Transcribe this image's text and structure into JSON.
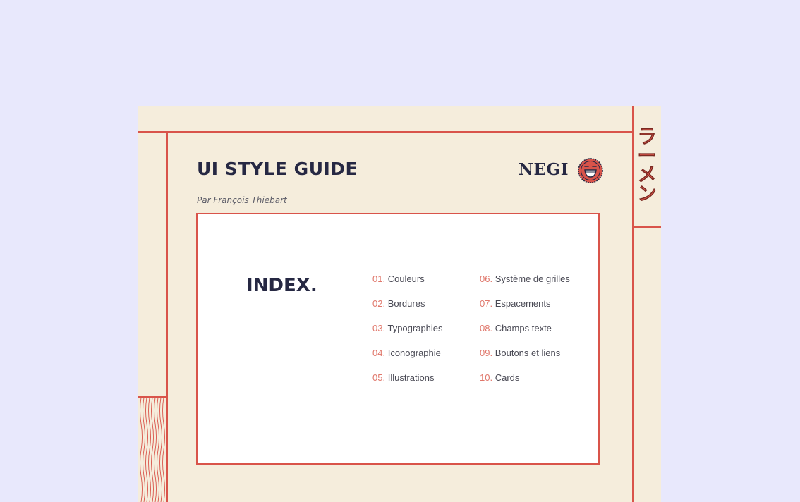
{
  "doc": {
    "title": "UI STYLE GUIDE",
    "author": "Par François Thiebart",
    "brand": "NEGI",
    "vertical_text": [
      "ラ",
      "ー",
      "メ",
      "ン"
    ]
  },
  "index": {
    "title": "INDEX.",
    "items": [
      {
        "num": "01.",
        "label": "Couleurs"
      },
      {
        "num": "02.",
        "label": "Bordures"
      },
      {
        "num": "03.",
        "label": "Typographies"
      },
      {
        "num": "04.",
        "label": "Iconographie"
      },
      {
        "num": "05.",
        "label": "Illustrations"
      },
      {
        "num": "06.",
        "label": "Système de grilles"
      },
      {
        "num": "07.",
        "label": "Espacements"
      },
      {
        "num": "08.",
        "label": "Champs texte"
      },
      {
        "num": "09.",
        "label": "Boutons et liens"
      },
      {
        "num": "10.",
        "label": "Cards"
      }
    ]
  },
  "colors": {
    "background": "#e8e8fc",
    "paper": "#f5eddc",
    "accent": "#d9544a",
    "navy": "#262843"
  },
  "icons": {
    "logo": "smiling-face-badge-icon",
    "waves": "wavy-lines-decoration"
  }
}
